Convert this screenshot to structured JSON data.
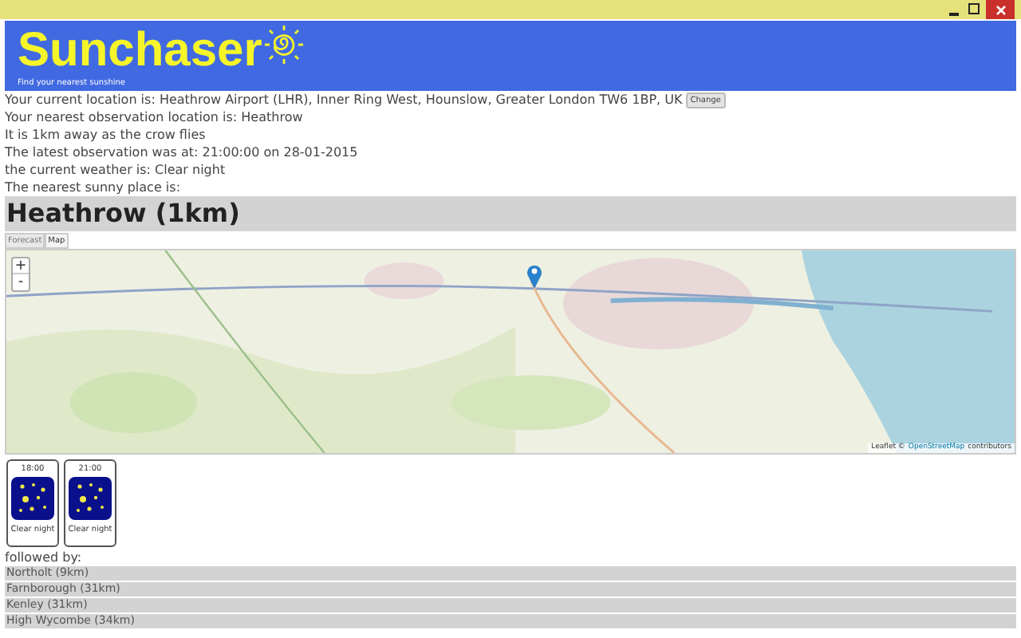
{
  "header": {
    "title": "Sunchaser",
    "tagline": "Find your nearest sunshine"
  },
  "location": {
    "text": "Your current location is: Heathrow Airport (LHR), Inner Ring West, Hounslow, Greater London TW6 1BP, UK",
    "button": "Change"
  },
  "info_lines": [
    "Your nearest observation location is: Heathrow",
    "It is 1km away as the crow flies",
    "The latest observation was at: 21:00:00 on 28-01-2015",
    "the current weather is: Clear night",
    "The nearest sunny place is:"
  ],
  "place_heading": "Heathrow (1km)",
  "tabs": [
    {
      "label": "Forecast",
      "selected": false
    },
    {
      "label": "Map",
      "selected": true
    }
  ],
  "map": {
    "zoom_in": "+",
    "zoom_out": "-",
    "attribution_prefix": "Leaflet ©",
    "attribution_link": "OpenStreetMap",
    "attribution_suffix": "contributors"
  },
  "forecast": [
    {
      "time": "18:00",
      "weather": "Clear night"
    },
    {
      "time": "21:00",
      "weather": "Clear night"
    }
  ],
  "followed_label": "followed by:",
  "places": [
    "Northolt (9km)",
    "Farnborough (31km)",
    "Kenley (31km)",
    "High Wycombe (34km)"
  ]
}
